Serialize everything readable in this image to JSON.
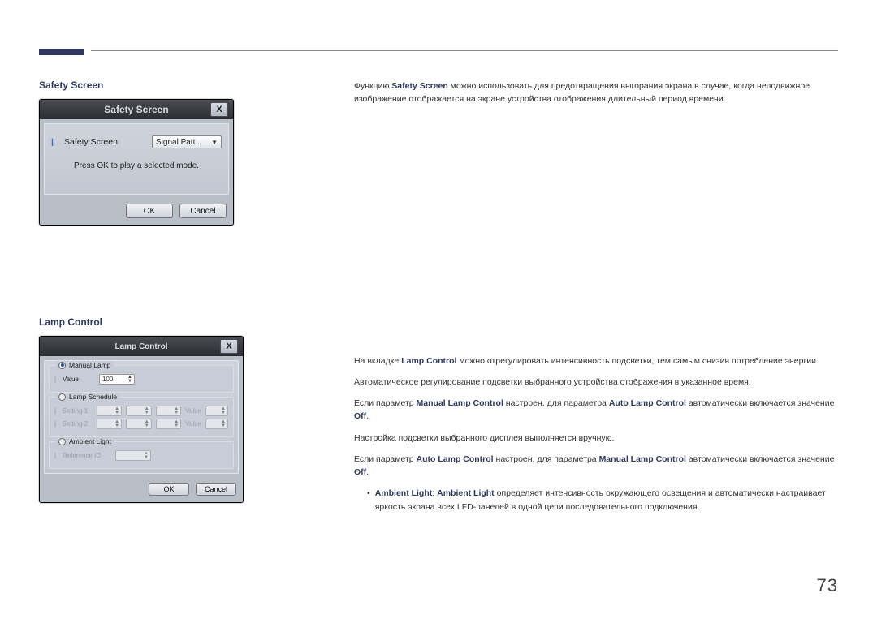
{
  "page": {
    "number": "73"
  },
  "section1": {
    "heading": "Safety Screen",
    "para": "Функцию Safety Screen можно использовать для предотвращения выгорания экрана в случае, когда неподвижное изображение отображается на экране устройства отображения длительный период времени.",
    "em": "Safety Screen",
    "dialog": {
      "title": "Safety Screen",
      "close": "X",
      "row_label": "Safety Screen",
      "dropdown_value": "Signal Patt...",
      "hint": "Press OK to play a selected mode.",
      "ok": "OK",
      "cancel": "Cancel"
    }
  },
  "section2": {
    "heading": "Lamp Control",
    "p1a": "На вкладке ",
    "p1_em": "Lamp Control",
    "p1b": " можно отрегулировать интенсивность подсветки, тем самым снизив потребление энергии.",
    "p2": "Автоматическое регулирование подсветки выбранного устройства отображения в указанное время.",
    "p3a": "Если параметр ",
    "p3_em1": "Manual Lamp Control",
    "p3b": " настроен, для параметра ",
    "p3_em2": "Auto Lamp Control",
    "p3c": " автоматически включается значение ",
    "p3_em3": "Off",
    "p3d": ".",
    "p4": "Настройка подсветки выбранного дисплея выполняется вручную.",
    "p5a": "Если параметр ",
    "p5_em1": "Auto Lamp Control",
    "p5b": " настроен, для параметра ",
    "p5_em2": "Manual Lamp Control",
    "p5c": " автоматически включается значение ",
    "p5_em3": "Off",
    "p5d": ".",
    "bullet_em": "Ambient Light",
    "bullet_sep": ": ",
    "bullet_em2": "Ambient Light",
    "bullet_txt": " определяет интенсивность окружающего освещения и автоматически настраивает яркость экрана всех LFD-панелей в одной цепи последовательного подключения.",
    "dialog": {
      "title": "Lamp Control",
      "close": "X",
      "group1_title": "Manual Lamp",
      "g1_value_label": "Value",
      "g1_value": "100",
      "group2_title": "Lamp Schedule",
      "g2_row1": "Setting 1",
      "g2_row2": "Setting 2",
      "g2_value_label": "Value",
      "group3_title": "Ambient Light",
      "g3_row": "Reference ID",
      "ok": "OK",
      "cancel": "Cancel"
    }
  }
}
